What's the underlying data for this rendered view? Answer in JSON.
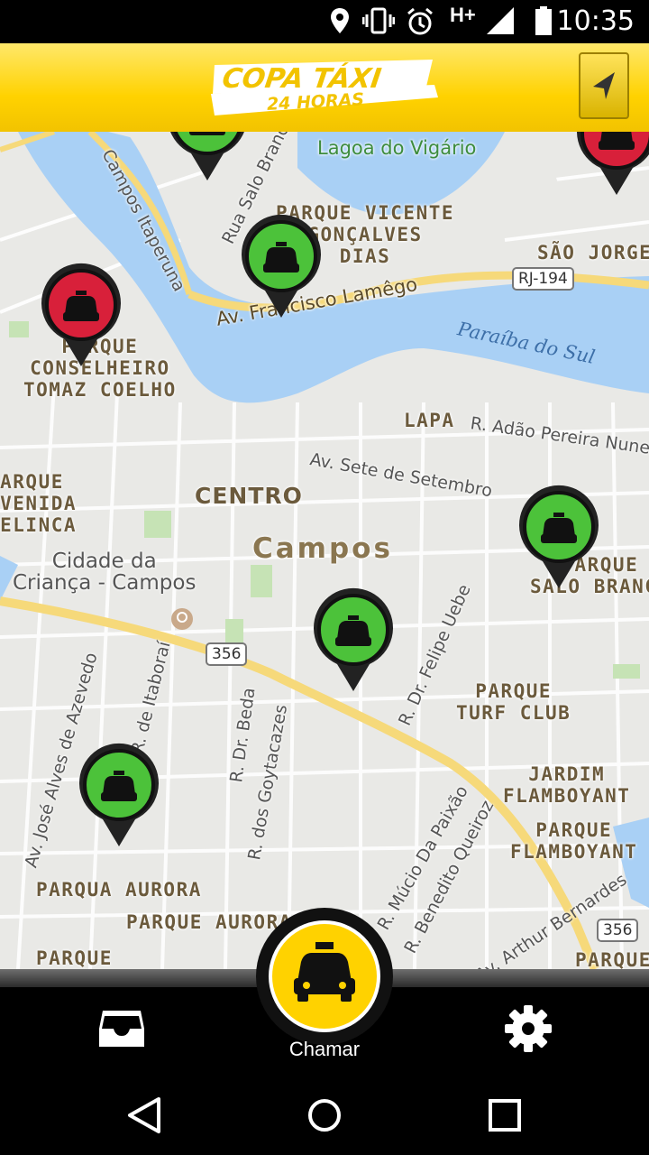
{
  "status_bar": {
    "time": "10:35",
    "network": "H+"
  },
  "header": {
    "logo_line1": "COPA TÁXI",
    "logo_line2": "24 HORAS"
  },
  "map": {
    "neighborhoods": [
      "PARQUE VICENTE\nGONÇALVES\nDIAS",
      "SÃO JORGE",
      "PARQUE\nCONSELHEIRO\nTOMAZ COELHO",
      "LAPA",
      "PARQUE\nAVENIDA\nPELINCA",
      "CENTRO",
      "PARQUE\nSALO BRANCO",
      "PARQUE\nTURF CLUB",
      "JARDIM\nFLAMBOYANT",
      "PARQUE\nFLAMBOYANT",
      "PARQUA AURORA",
      "PARQUE AURORA",
      "PARQUE",
      "PARQUE"
    ],
    "city": "Campos",
    "poi": "Cidade da\nCriança - Campos",
    "lagoon": "Lagoa do Vigário",
    "river": "Paraíba do Sul",
    "streets": [
      "Campos Itaperuna",
      "Rua Salo Branco",
      "Av. Francisco Lamêgo",
      "R. Adão Pereira Nunes",
      "Av. Sete de Setembro",
      "R. Dr. Felipe Uebe",
      "Av. José Alves de Azevedo",
      "R. de Itaboraí",
      "R. Dr. Beda",
      "R. dos Goytacazes",
      "R. Múcio Da Paixão",
      "R. Benedito Queiroz",
      "Av. Arthur Bernardes"
    ],
    "shields": [
      "RJ-194",
      "356",
      "356"
    ],
    "taxis": [
      {
        "status": "available",
        "color": "#4cc23a"
      },
      {
        "status": "available",
        "color": "#4cc23a"
      },
      {
        "status": "busy",
        "color": "#d8203a"
      },
      {
        "status": "busy",
        "color": "#d8203a"
      },
      {
        "status": "available",
        "color": "#4cc23a"
      },
      {
        "status": "available",
        "color": "#4cc23a"
      },
      {
        "status": "available",
        "color": "#4cc23a"
      }
    ]
  },
  "bottom": {
    "call_label": "Chamar"
  },
  "colors": {
    "brand": "#ffd200",
    "available": "#4cc23a",
    "busy": "#d8203a",
    "water": "#a9d0f5"
  },
  "icons": [
    "location-icon",
    "vibrate-icon",
    "alarm-icon",
    "signal-icon",
    "battery-icon",
    "navigate-arrow-icon",
    "taxi-icon",
    "inbox-icon",
    "gear-icon",
    "back-icon",
    "home-icon",
    "recents-icon"
  ]
}
